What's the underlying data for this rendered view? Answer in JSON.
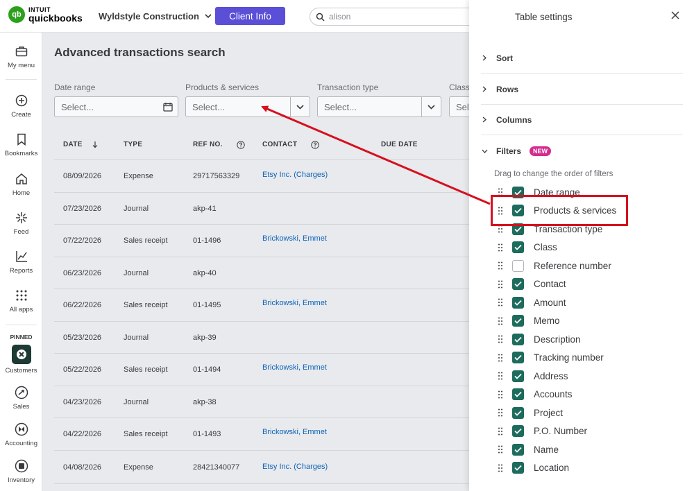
{
  "app": {
    "logo_brand": "INTUIT",
    "logo_product": "quickbooks",
    "company_name": "Wyldstyle Construction",
    "client_info_button": "Client Info",
    "search_value": "alison"
  },
  "nav": {
    "items": [
      {
        "label": "My menu",
        "icon": "briefcase-icon"
      },
      {
        "label": "Create",
        "icon": "plus-circle-icon"
      },
      {
        "label": "Bookmarks",
        "icon": "bookmark-icon"
      },
      {
        "label": "Home",
        "icon": "home-icon"
      },
      {
        "label": "Feed",
        "icon": "sparkle-icon"
      },
      {
        "label": "Reports",
        "icon": "chart-line-icon"
      },
      {
        "label": "All apps",
        "icon": "grid-icon"
      }
    ],
    "pinned_label": "PINNED",
    "pinned": [
      {
        "label": "Customers",
        "icon": "customers-icon"
      },
      {
        "label": "Sales",
        "icon": "sales-icon"
      },
      {
        "label": "Accounting",
        "icon": "accounting-icon"
      },
      {
        "label": "Inventory",
        "icon": "inventory-icon"
      }
    ]
  },
  "main": {
    "title": "Advanced transactions search",
    "filters": [
      {
        "label": "Date range",
        "placeholder": "Select..."
      },
      {
        "label": "Products & services",
        "placeholder": "Select..."
      },
      {
        "label": "Transaction type",
        "placeholder": "Select..."
      },
      {
        "label": "Class",
        "placeholder": "Sele"
      }
    ],
    "columns": [
      "DATE",
      "TYPE",
      "REF NO.",
      "CONTACT",
      "DUE DATE"
    ],
    "rows": [
      {
        "date": "08/09/2026",
        "type": "Expense",
        "ref": "29717563329",
        "contact": "Etsy Inc. (Charges)"
      },
      {
        "date": "07/23/2026",
        "type": "Journal",
        "ref": "akp-41",
        "contact": ""
      },
      {
        "date": "07/22/2026",
        "type": "Sales receipt",
        "ref": "01-1496",
        "contact": "Brickowski, Emmet"
      },
      {
        "date": "06/23/2026",
        "type": "Journal",
        "ref": "akp-40",
        "contact": ""
      },
      {
        "date": "06/22/2026",
        "type": "Sales receipt",
        "ref": "01-1495",
        "contact": "Brickowski, Emmet"
      },
      {
        "date": "05/23/2026",
        "type": "Journal",
        "ref": "akp-39",
        "contact": ""
      },
      {
        "date": "05/22/2026",
        "type": "Sales receipt",
        "ref": "01-1494",
        "contact": "Brickowski, Emmet"
      },
      {
        "date": "04/23/2026",
        "type": "Journal",
        "ref": "akp-38",
        "contact": ""
      },
      {
        "date": "04/22/2026",
        "type": "Sales receipt",
        "ref": "01-1493",
        "contact": "Brickowski, Emmet"
      },
      {
        "date": "04/08/2026",
        "type": "Expense",
        "ref": "28421340077",
        "contact": "Etsy Inc. (Charges)"
      }
    ]
  },
  "panel": {
    "title": "Table settings",
    "sections": [
      {
        "label": "Sort",
        "expanded": false
      },
      {
        "label": "Rows",
        "expanded": false
      },
      {
        "label": "Columns",
        "expanded": false
      },
      {
        "label": "Filters",
        "expanded": true,
        "badge": "NEW"
      }
    ],
    "hint": "Drag to change the order of filters",
    "filters": [
      {
        "label": "Date range",
        "checked": true
      },
      {
        "label": "Products & services",
        "checked": true
      },
      {
        "label": "Transaction type",
        "checked": true
      },
      {
        "label": "Class",
        "checked": true
      },
      {
        "label": "Reference number",
        "checked": false
      },
      {
        "label": "Contact",
        "checked": true
      },
      {
        "label": "Amount",
        "checked": true
      },
      {
        "label": "Memo",
        "checked": true
      },
      {
        "label": "Description",
        "checked": true
      },
      {
        "label": "Tracking number",
        "checked": true
      },
      {
        "label": "Address",
        "checked": true
      },
      {
        "label": "Accounts",
        "checked": true
      },
      {
        "label": "Project",
        "checked": true
      },
      {
        "label": "P.O. Number",
        "checked": true
      },
      {
        "label": "Name",
        "checked": true
      },
      {
        "label": "Location",
        "checked": true
      }
    ]
  },
  "colors": {
    "accent_green": "#1d6b5c",
    "client_info_purple": "#5a4fd6",
    "link_blue": "#0d63b8",
    "annotation_red": "#d6101f",
    "new_badge_pink": "#d52b8f"
  }
}
